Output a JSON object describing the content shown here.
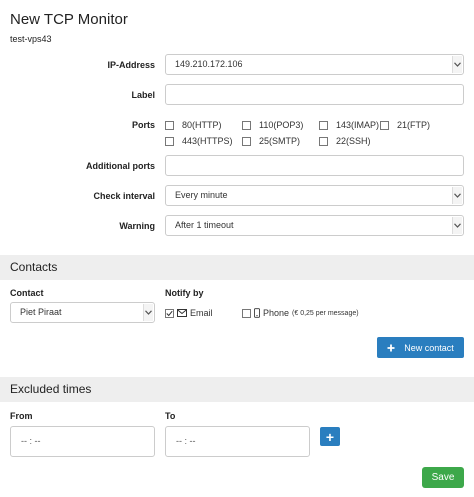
{
  "header": {
    "title": "New TCP Monitor",
    "subtitle": "test-vps43"
  },
  "form": {
    "ip_label": "IP-Address",
    "ip_value": "149.210.172.106",
    "label_label": "Label",
    "label_value": "",
    "ports_label": "Ports",
    "ports": [
      "80(HTTP)",
      "110(POP3)",
      "143(IMAP)",
      "21(FTP)",
      "443(HTTPS)",
      "25(SMTP)",
      "22(SSH)"
    ],
    "additional_label": "Additional ports",
    "additional_value": "",
    "interval_label": "Check interval",
    "interval_value": "Every minute",
    "warning_label": "Warning",
    "warning_value": "After 1 timeout"
  },
  "contacts": {
    "section_title": "Contacts",
    "contact_label": "Contact",
    "contact_value": "Piet Piraat",
    "notify_label": "Notify by",
    "email_label": "Email",
    "phone_label": "Phone",
    "phone_note": "(€ 0,25 per message)",
    "email_checked": true,
    "phone_checked": false,
    "new_contact_label": "New contact"
  },
  "excluded": {
    "section_title": "Excluded times",
    "from_label": "From",
    "to_label": "To",
    "from_placeholder": "-- : --",
    "to_placeholder": "-- : --",
    "add_label": "+"
  },
  "footer": {
    "save_label": "Save"
  },
  "colors": {
    "primary": "#2a7ebf",
    "success": "#3da84a",
    "section_bg": "#eeeeee"
  }
}
